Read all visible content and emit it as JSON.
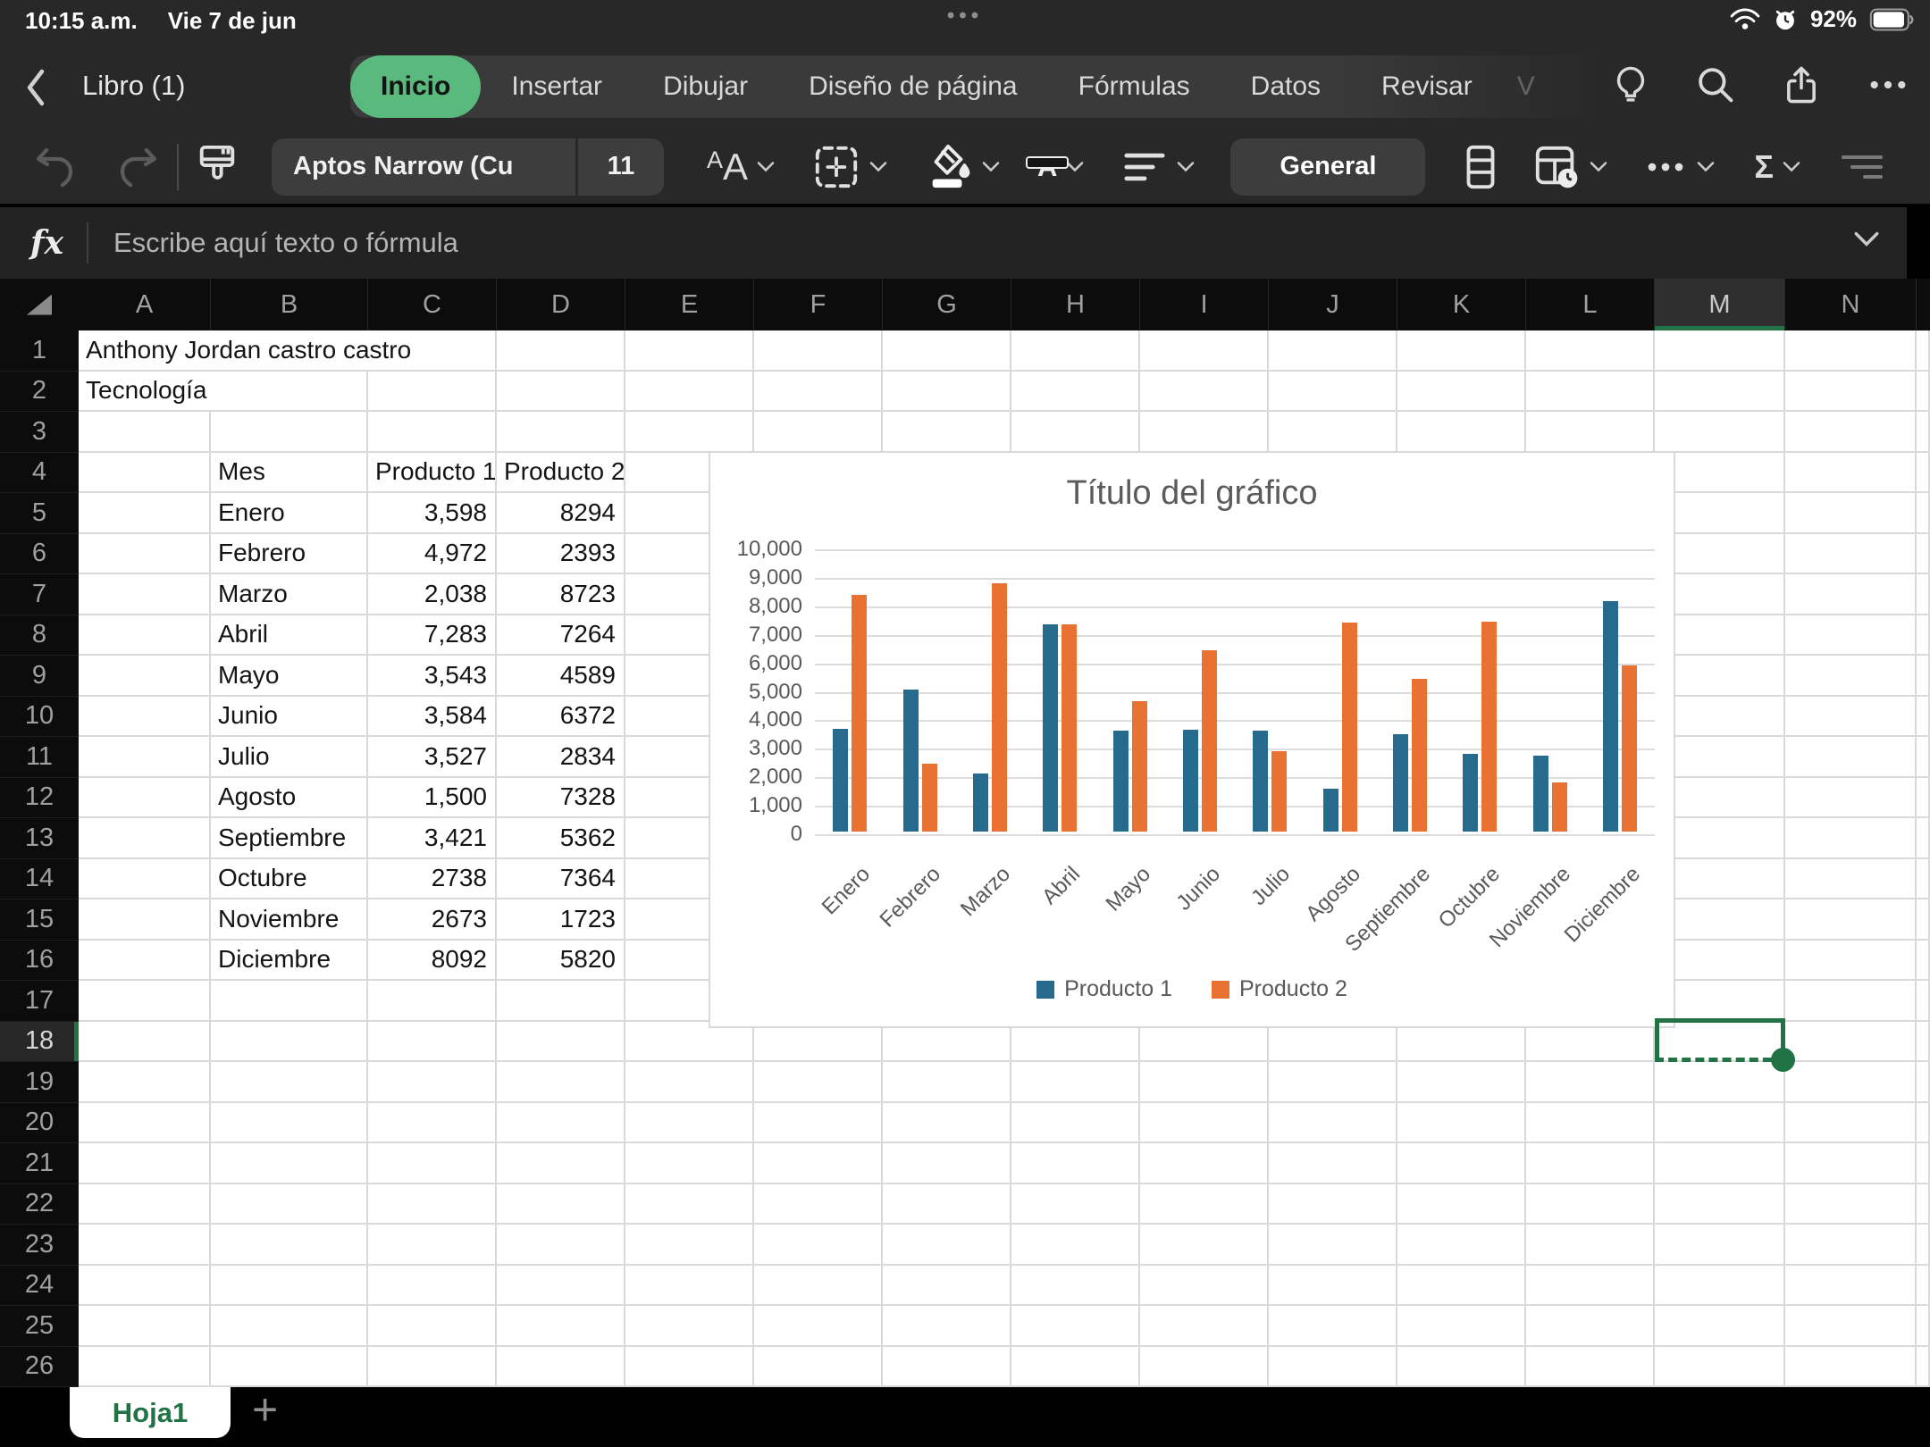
{
  "status_bar": {
    "time": "10:15 a.m.",
    "date": "Vie 7 de jun",
    "battery_percent": "92%",
    "overflow_dots": "•••"
  },
  "title_bar": {
    "workbook_title": "Libro (1)",
    "ribbon_tabs": [
      {
        "label": "Inicio",
        "active": true
      },
      {
        "label": "Insertar"
      },
      {
        "label": "Dibujar"
      },
      {
        "label": "Diseño de página"
      },
      {
        "label": "Fórmulas"
      },
      {
        "label": "Datos"
      },
      {
        "label": "Revisar"
      },
      {
        "label": "V",
        "faded": true
      }
    ]
  },
  "toolbar": {
    "font_name": "Aptos Narrow (Cu",
    "font_size": "11",
    "number_format_label": "General",
    "sum_symbol": "Σ"
  },
  "formula_bar": {
    "fx_label": "fx",
    "placeholder": "Escribe aquí texto o fórmula"
  },
  "sheet": {
    "column_letters": [
      "A",
      "B",
      "C",
      "D",
      "E",
      "F",
      "G",
      "H",
      "I",
      "J",
      "K",
      "L",
      "M",
      "N"
    ],
    "row_count": 26,
    "active_cell": {
      "column": "M",
      "row": 18
    },
    "cells": {
      "A1": "Anthony Jordan castro castro",
      "A2": "Tecnología",
      "table": {
        "start_row": 4,
        "columns": [
          "B",
          "C",
          "D"
        ],
        "header": [
          "Mes",
          "Producto 1",
          "Producto 2"
        ],
        "rows": [
          [
            "Enero",
            "3,598",
            "8294"
          ],
          [
            "Febrero",
            "4,972",
            "2393"
          ],
          [
            "Marzo",
            "2,038",
            "8723"
          ],
          [
            "Abril",
            "7,283",
            "7264"
          ],
          [
            "Mayo",
            "3,543",
            "4589"
          ],
          [
            "Junio",
            "3,584",
            "6372"
          ],
          [
            "Julio",
            "3,527",
            "2834"
          ],
          [
            "Agosto",
            "1,500",
            "7328"
          ],
          [
            "Septiembre",
            "3,421",
            "5362"
          ],
          [
            "Octubre",
            "2738",
            "7364"
          ],
          [
            "Noviembre",
            "2673",
            "1723"
          ],
          [
            "Diciembre",
            "8092",
            "5820"
          ]
        ]
      }
    }
  },
  "chart_data": {
    "type": "bar",
    "title": "Título del gráfico",
    "categories": [
      "Enero",
      "Febrero",
      "Marzo",
      "Abril",
      "Mayo",
      "Junio",
      "Julio",
      "Agosto",
      "Septiembre",
      "Octubre",
      "Noviembre",
      "Diciembre"
    ],
    "series": [
      {
        "name": "Producto 1",
        "color": "#266b8e",
        "values": [
          3598,
          4972,
          2038,
          7283,
          3543,
          3584,
          3527,
          1500,
          3421,
          2738,
          2673,
          8092
        ]
      },
      {
        "name": "Producto 2",
        "color": "#e97132",
        "values": [
          8294,
          2393,
          8723,
          7264,
          4589,
          6372,
          2834,
          7328,
          5362,
          7364,
          1723,
          5820
        ]
      }
    ],
    "xlabel": "",
    "ylabel": "",
    "ylim": [
      0,
      10000
    ],
    "ytick_step": 1000,
    "grid": true,
    "legend_position": "bottom"
  },
  "sheet_bar": {
    "tabs": [
      {
        "label": "Hoja1",
        "active": true
      }
    ],
    "add_button": "+"
  },
  "colors": {
    "excel_green": "#217346",
    "active_tab_green": "#5ab97c",
    "series1": "#266b8e",
    "series2": "#e97132",
    "chrome_bg": "#282828",
    "header_bg": "#0c0c0c"
  }
}
